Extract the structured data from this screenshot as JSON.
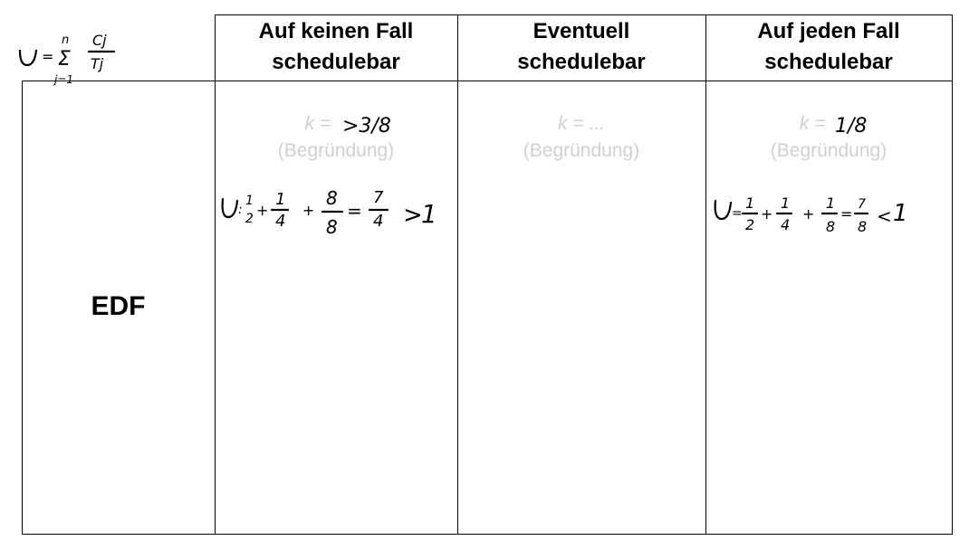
{
  "formula": {
    "lhs": "U",
    "eq": "=",
    "sum_upper": "n",
    "sum_symbol": "Σ",
    "sum_lower": "j=1",
    "num": "Cj",
    "den": "Tj"
  },
  "headers": {
    "col1": [
      "Auf keinen Fall",
      "schedulebar"
    ],
    "col2": [
      "Eventuell",
      "schedulebar"
    ],
    "col3": [
      "Auf jeden Fall",
      "schedulebar"
    ]
  },
  "row_label": "EDF",
  "cells": {
    "col1": {
      "k_prefix": "k = ",
      "k_value": ">3/8",
      "reason": "(Begründung)"
    },
    "col2": {
      "k_prefix": "k = ...",
      "reason": "(Begründung)"
    },
    "col3": {
      "k_prefix": "k = ",
      "k_value": "1/8",
      "reason": "(Begründung)"
    }
  },
  "calc": {
    "col1": {
      "u": "U",
      "colon": ":",
      "terms": [
        [
          "1",
          "2"
        ],
        [
          "1",
          "4"
        ],
        [
          "8",
          "8"
        ]
      ],
      "eq": "=",
      "result": [
        "7",
        "4"
      ],
      "cmp": ">",
      "rhs": "1"
    },
    "col3": {
      "u": "U",
      "colon": "=",
      "terms": [
        [
          "1",
          "2"
        ],
        [
          "1",
          "4"
        ],
        [
          "1",
          "8"
        ]
      ],
      "eq": "=",
      "result": [
        "7",
        "8"
      ],
      "cmp": "<",
      "rhs": "1"
    }
  }
}
